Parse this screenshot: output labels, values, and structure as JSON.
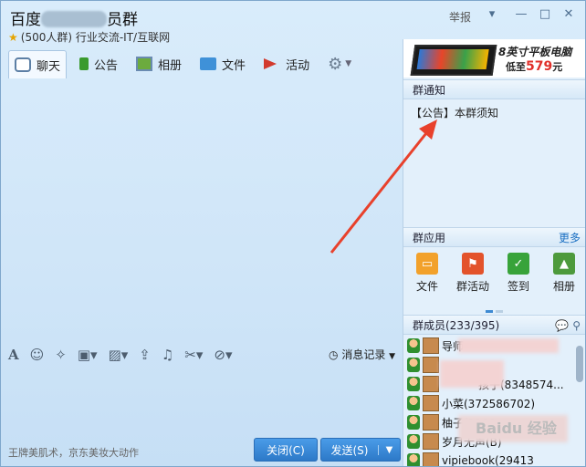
{
  "window": {
    "title_left": "百度",
    "title_right": "员群",
    "subtitle": "(500人群) 行业交流-IT/互联网",
    "report": "举报",
    "controls": {
      "dropdown": "▾",
      "minimize": "—",
      "maximize": "□",
      "close": "✕"
    }
  },
  "tabs": [
    {
      "label": "聊天",
      "icon": "chat-icon"
    },
    {
      "label": "公告",
      "icon": "announcement-icon"
    },
    {
      "label": "相册",
      "icon": "album-icon"
    },
    {
      "label": "文件",
      "icon": "folder-icon"
    },
    {
      "label": "活动",
      "icon": "flag-icon"
    }
  ],
  "ad_banner": {
    "line1": "8英寸平板电脑",
    "price_prefix": "低至",
    "price": "579",
    "price_unit": "元"
  },
  "notice": {
    "header": "群通知",
    "text": "【公告】本群须知"
  },
  "apps": {
    "header": "群应用",
    "more": "更多",
    "items": [
      {
        "label": "文件",
        "icon": "folder-icon",
        "color": "#f2a12b",
        "glyph": "▭"
      },
      {
        "label": "群活动",
        "icon": "flag-icon",
        "color": "#e3532b",
        "glyph": "⚑"
      },
      {
        "label": "签到",
        "icon": "checkin-icon",
        "color": "#38a33a",
        "glyph": "✓"
      },
      {
        "label": "相册",
        "icon": "album-icon",
        "color": "#4d9a3c",
        "glyph": "▲"
      }
    ]
  },
  "members": {
    "header": "群成员(233/395)",
    "list": [
      {
        "name": "导师"
      },
      {
        "name": ""
      },
      {
        "name": "孩子(8348574..."
      },
      {
        "name": "小菜(372586702)"
      },
      {
        "name": "柚子(1190"
      },
      {
        "name": "岁月无声(B)"
      },
      {
        "name": "vipiebook(29413"
      }
    ]
  },
  "input": {
    "history": "消息记录",
    "ad_text": "王牌美肌术，京东美妆大动作",
    "close_label": "关闭(C)",
    "send_label": "发送(S)"
  },
  "watermark": "Baidu 经验",
  "colors": {
    "accent": "#2d79c8",
    "arrow": "#e8412c"
  }
}
